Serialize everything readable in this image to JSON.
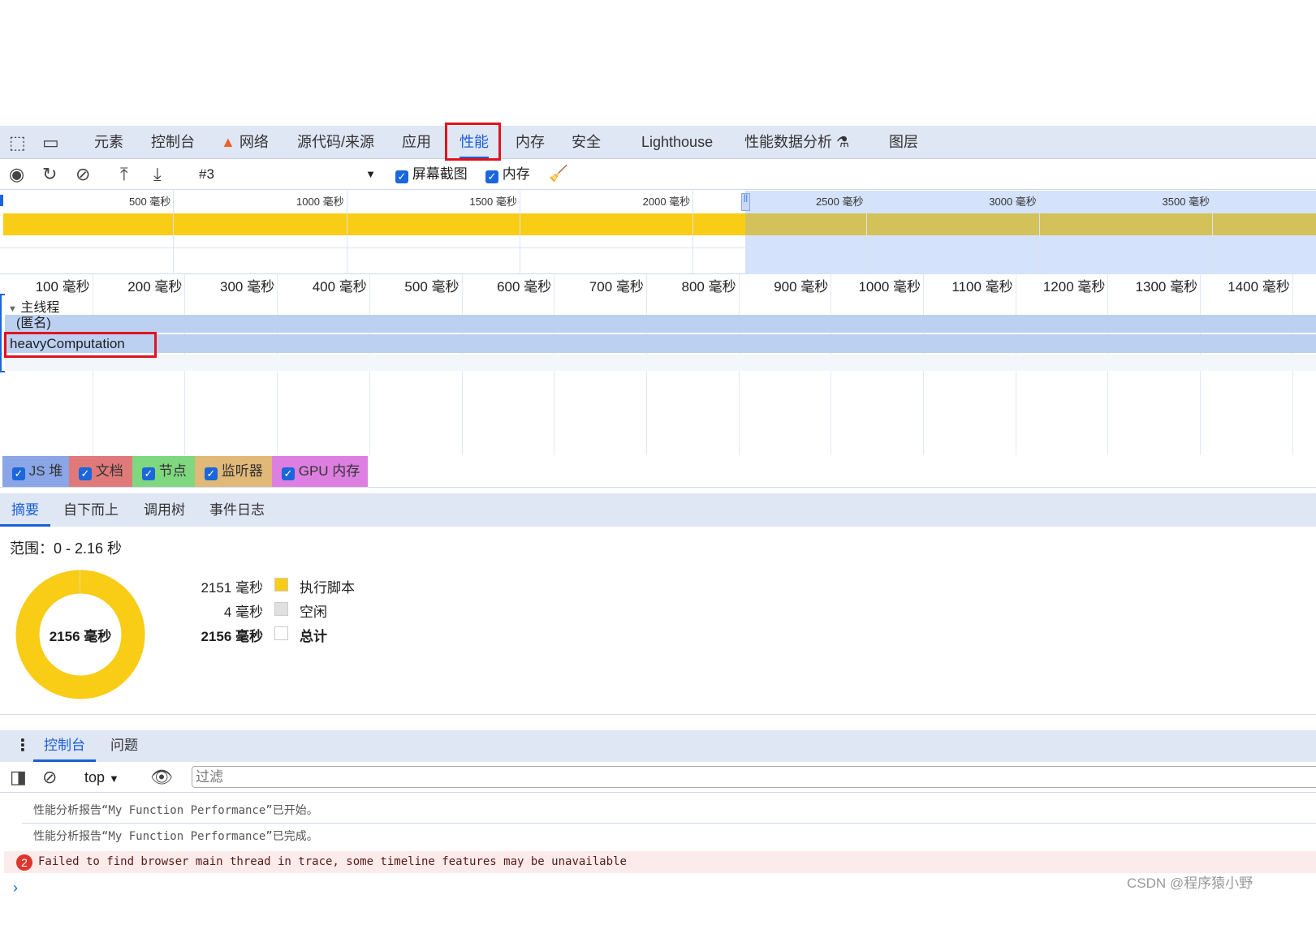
{
  "tabs": [
    {
      "label": "元素"
    },
    {
      "label": "控制台"
    },
    {
      "label": "网络",
      "warning": true
    },
    {
      "label": "源代码/来源"
    },
    {
      "label": "应用"
    },
    {
      "label": "性能",
      "active": true
    },
    {
      "label": "内存"
    },
    {
      "label": "安全"
    },
    {
      "label": "Lighthouse"
    },
    {
      "label": "性能数据分析"
    },
    {
      "label": "图层"
    }
  ],
  "toolbar": {
    "recording": "#3",
    "screenshots": "屏幕截图",
    "memory": "内存"
  },
  "overview_ticks": [
    "500 毫秒",
    "1000 毫秒",
    "1500 毫秒",
    "2000 毫秒",
    "2500 毫秒",
    "3000 毫秒",
    "3500 毫秒"
  ],
  "ruler_ticks": [
    "100 毫秒",
    "200 毫秒",
    "300 毫秒",
    "400 毫秒",
    "500 毫秒",
    "600 毫秒",
    "700 毫秒",
    "800 毫秒",
    "900 毫秒",
    "1000 毫秒",
    "1100 毫秒",
    "1200 毫秒",
    "1300 毫秒",
    "1400 毫秒"
  ],
  "track": {
    "title": "主线程",
    "rows": [
      "(匿名)",
      "heavyComputation"
    ]
  },
  "memory_legend": [
    {
      "label": "JS 堆",
      "color": "#8aa6e6"
    },
    {
      "label": "文档",
      "color": "#e07a7a"
    },
    {
      "label": "节点",
      "color": "#7fd87f"
    },
    {
      "label": "监听器",
      "color": "#e0b878"
    },
    {
      "label": "GPU 内存",
      "color": "#dc7fe0"
    }
  ],
  "bottom_tabs": [
    "摘要",
    "自下而上",
    "调用树",
    "事件日志"
  ],
  "summary": {
    "range": "范围：0 - 2.16 秒",
    "center": "2156 毫秒",
    "scripting_fraction": 0.998,
    "rows": [
      {
        "value": "2151 毫秒",
        "label": "执行脚本",
        "color": "#f9cc15"
      },
      {
        "value": "4 毫秒",
        "label": "空闲",
        "color": "#e0e0e0"
      },
      {
        "value": "2156 毫秒",
        "label": "总计",
        "color": "#ffffff"
      }
    ]
  },
  "drawer": {
    "tabs": [
      "控制台",
      "问题"
    ],
    "context": "top",
    "filter_placeholder": "过滤",
    "messages": [
      "性能分析报告“My Function Performance”已开始。",
      "性能分析报告“My Function Performance”已完成。"
    ],
    "error": {
      "count": "2",
      "text": "Failed to find browser main thread in trace, some timeline features may be unavailable"
    }
  },
  "watermark": "CSDN @程序猿小野"
}
